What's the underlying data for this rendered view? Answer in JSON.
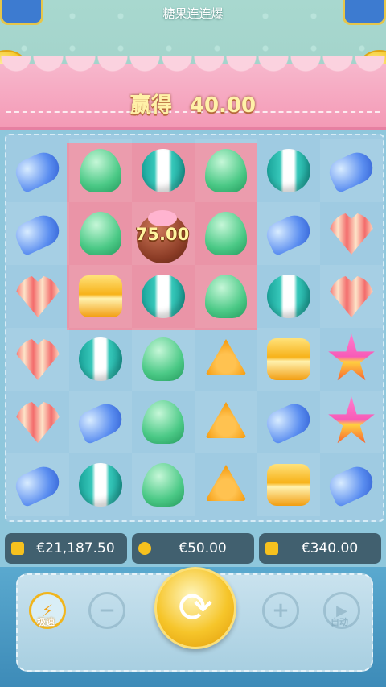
{
  "header": {
    "title": "糖果连连爆"
  },
  "win_banner": {
    "label": "赢得",
    "amount": "40.00"
  },
  "bomb": {
    "multiplier_text": "75.00"
  },
  "grid": {
    "rows": [
      [
        "jelly",
        "gum",
        "ball",
        "gum",
        "ball",
        "jelly"
      ],
      [
        "jelly",
        "gum",
        "bomb",
        "gum",
        "jelly",
        "heart"
      ],
      [
        "heart",
        "caramel",
        "ball",
        "gum",
        "ball",
        "heart"
      ],
      [
        "heart",
        "ball",
        "gum",
        "triangle",
        "caramel",
        "star"
      ],
      [
        "heart",
        "jelly",
        "gum",
        "triangle",
        "jelly",
        "star"
      ],
      [
        "jelly",
        "ball",
        "gum",
        "triangle",
        "caramel",
        "jelly"
      ]
    ]
  },
  "info_bar": {
    "balance": {
      "icon": "wallet-icon",
      "value": "€21,187.50"
    },
    "bet": {
      "icon": "coins-icon",
      "value": "€50.00"
    },
    "win": {
      "icon": "trophy-icon",
      "value": "€340.00"
    }
  },
  "controls": {
    "turbo_label": "极速",
    "auto_label": "自动",
    "minus_glyph": "−",
    "plus_glyph": "+",
    "spin_glyph": "⟳",
    "turbo_glyph": "⚡",
    "auto_glyph": "▶"
  },
  "colors": {
    "banner": "#f49ab6",
    "win_text": "#fff1a8",
    "board": "#9fcbe2",
    "highlight": "#f28ea1",
    "spin": "#f6c52a"
  }
}
